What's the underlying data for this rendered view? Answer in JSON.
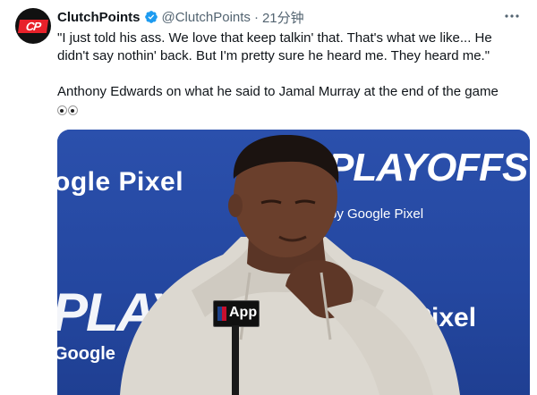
{
  "account": {
    "display_name": "ClutchPoints",
    "handle": "@ClutchPoints",
    "separator": "·",
    "time": "21分钟",
    "avatar_text": "CP"
  },
  "tweet": {
    "quote": "\"I just told his ass. We love that keep talkin' that. That's what we like... He didn't say nothin' back. But I'm pretty sure he heard me. They heard me.\"",
    "caption": "Anthony Edwards on what he said to Jamal Murray at the end of the game"
  },
  "media": {
    "backdrop_text_1": "ogle Pixel",
    "backdrop_playoffs": "PLAYOFFS",
    "backdrop_by_google": "by Google Pixel",
    "backdrop_playoffs_2": "PLAYO",
    "backdrop_google_2": "Google",
    "backdrop_pixel_2": "Pixel",
    "mic_flag": "App"
  },
  "icons": {
    "verified": "verified-badge-icon",
    "more": "more-options-icon",
    "emoji": "eyes-emoji-icon"
  },
  "colors": {
    "verified_blue": "#1d9bf0",
    "secondary_text": "#536471",
    "primary_text": "#0f1419",
    "backdrop_blue": "#2b50ac",
    "brand_red": "#e8212a"
  }
}
